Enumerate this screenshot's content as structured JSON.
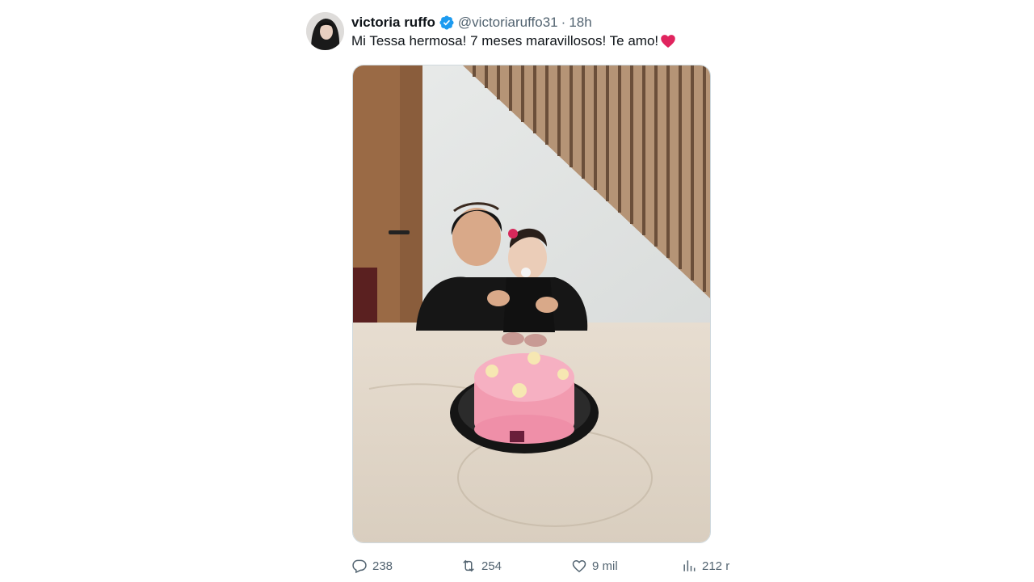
{
  "tweet": {
    "author": {
      "display_name": "victoria ruffo",
      "handle": "@victoriaruffo31",
      "verified": true
    },
    "separator": "·",
    "timestamp": "18h",
    "text": "Mi Tessa hermosa! 7 meses maravillosos! Te amo!",
    "emoji": "red-heart",
    "media_description_icon": "photo"
  },
  "actions": {
    "replies": "238",
    "retweets": "254",
    "likes": "9 mil",
    "views": "212 r"
  },
  "colors": {
    "text_primary": "#0f1419",
    "text_secondary": "#536471",
    "verified_blue": "#1d9bf0",
    "heart_red": "#e0245e",
    "border": "#cfd9de"
  }
}
